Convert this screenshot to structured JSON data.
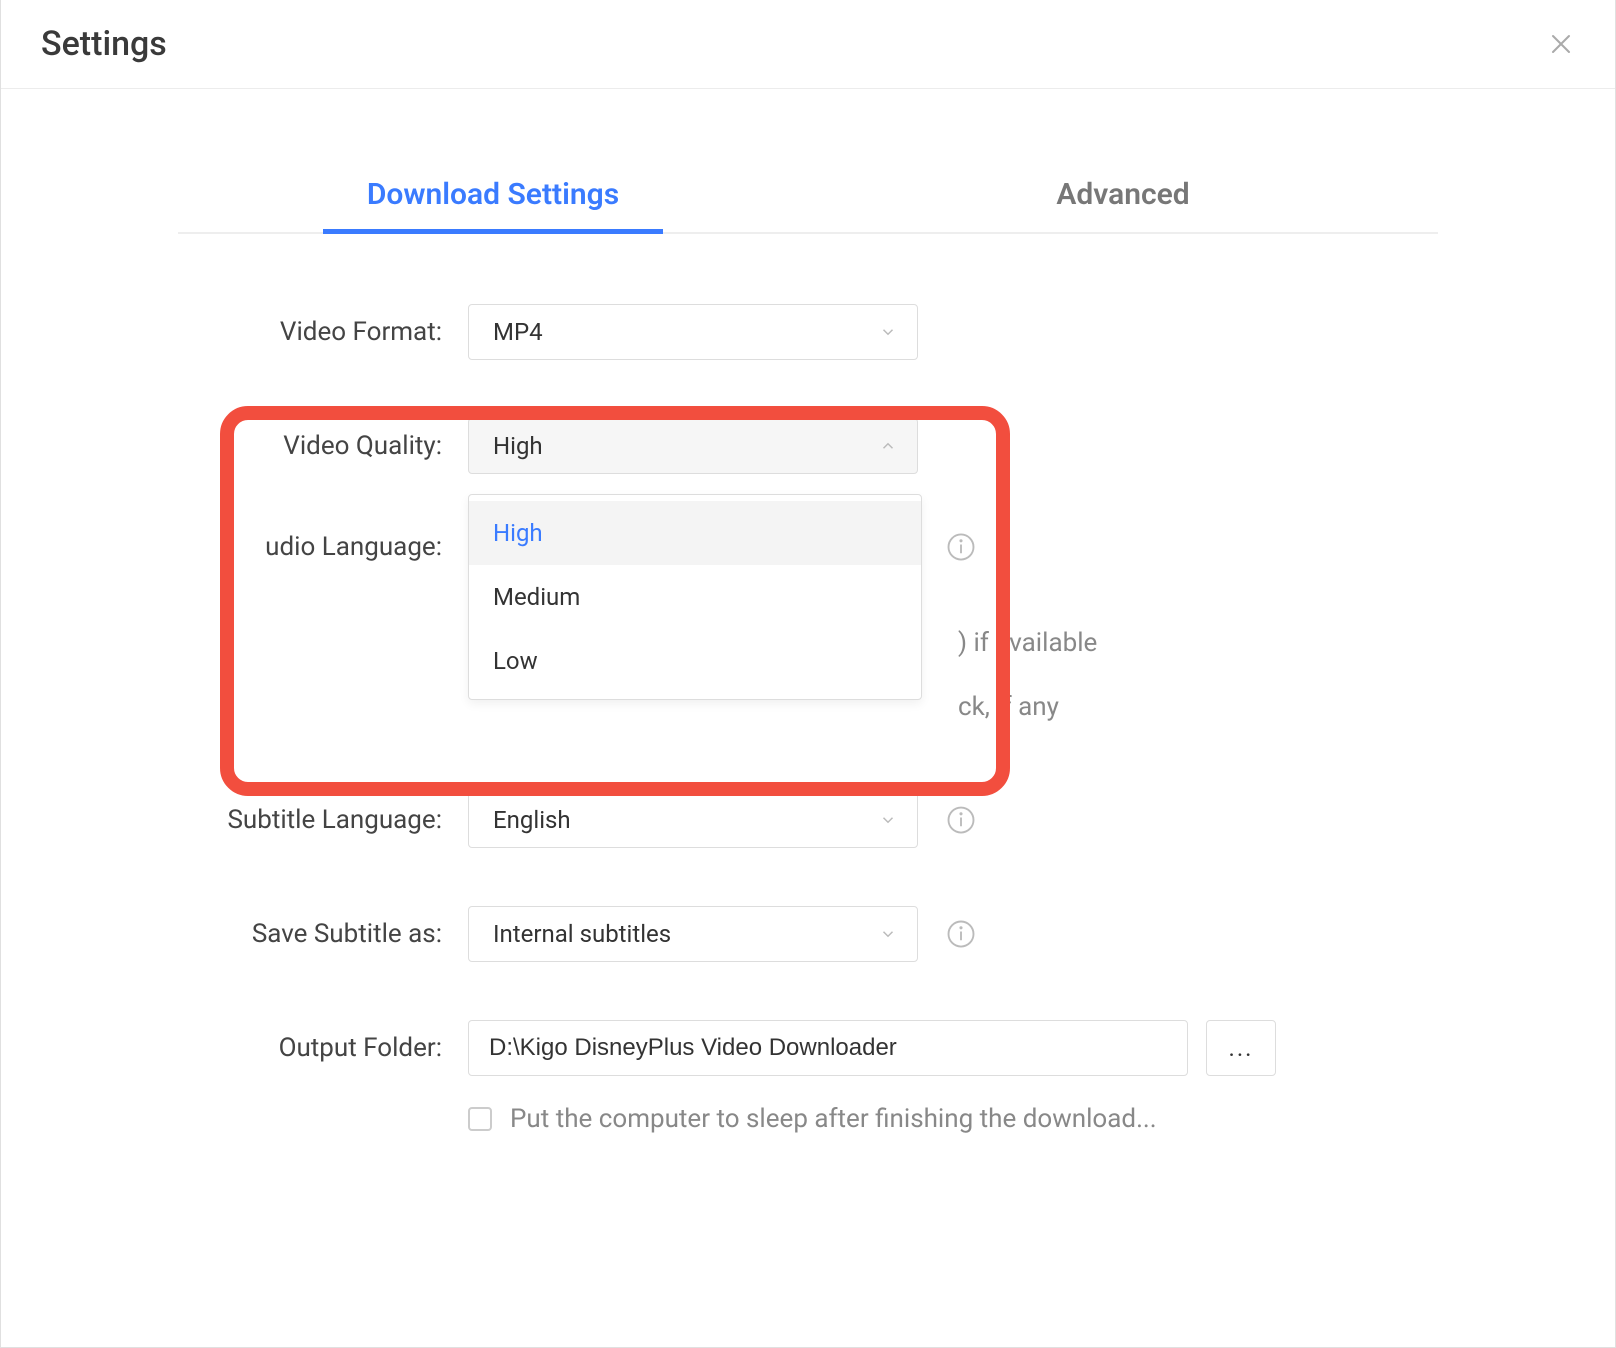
{
  "window": {
    "title": "Settings",
    "close_label": "Close"
  },
  "tabs": {
    "items": [
      {
        "label": "Download Settings",
        "active": true
      },
      {
        "label": "Advanced",
        "active": false
      }
    ]
  },
  "settings": {
    "video_format": {
      "label": "Video Format:",
      "value": "MP4"
    },
    "video_quality": {
      "label": "Video Quality:",
      "value": "High",
      "options": [
        "High",
        "Medium",
        "Low"
      ]
    },
    "audio_language": {
      "label": "udio Language:",
      "hint1_suffix": ") if available",
      "hint2_suffix": "ck, if any"
    },
    "subtitle_language": {
      "label": "Subtitle Language:",
      "value": "English"
    },
    "save_subtitle": {
      "label": "Save Subtitle as:",
      "value": "Internal subtitles"
    },
    "output_folder": {
      "label": "Output Folder:",
      "value": "D:\\Kigo DisneyPlus Video Downloader",
      "browse": "..."
    },
    "sleep_after": {
      "label": "Put the computer to sleep after finishing the download..."
    }
  }
}
